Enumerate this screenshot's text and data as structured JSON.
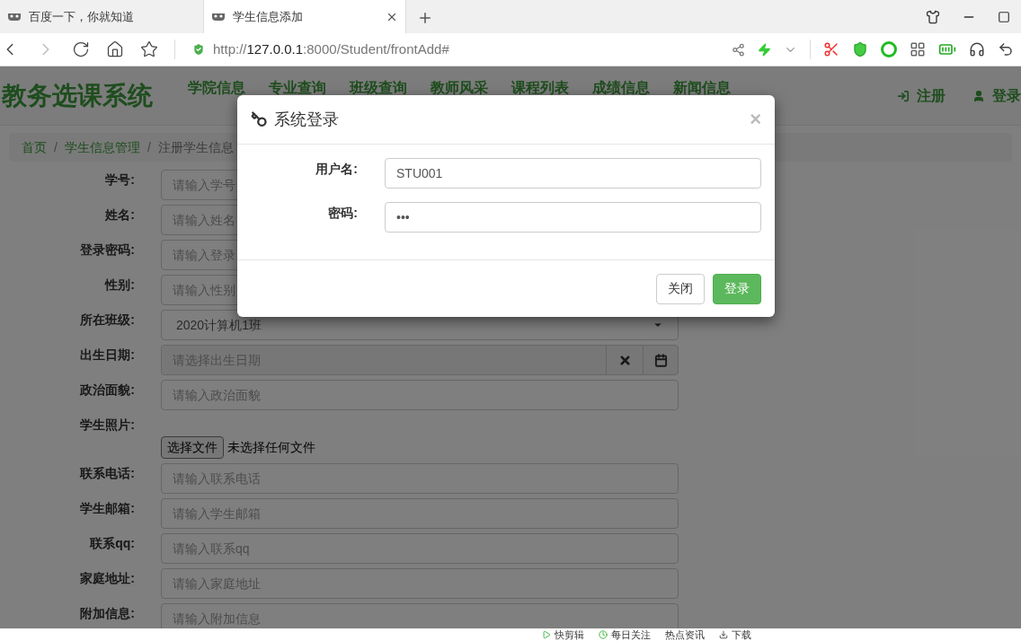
{
  "browser": {
    "tabs": [
      {
        "title": "百度一下，你就知道",
        "selected": false
      },
      {
        "title": "学生信息添加",
        "selected": true
      }
    ],
    "url": {
      "scheme": "http://",
      "host": "127.0.0.1",
      "path": ":8000/Student/frontAdd#"
    }
  },
  "navbar": {
    "brand": "教务选课系统",
    "items": [
      "学院信息",
      "专业查询",
      "班级查询",
      "教师风采",
      "课程列表",
      "成绩信息",
      "新闻信息"
    ],
    "right": [
      {
        "kind": "register",
        "label": "注册"
      },
      {
        "kind": "login",
        "label": "登录"
      }
    ]
  },
  "breadcrumb": {
    "items": [
      "首页",
      "学生信息管理",
      "注册学生信息"
    ],
    "separators": [
      "/",
      "/"
    ]
  },
  "form": [
    {
      "kind": "text",
      "label": "学号:",
      "placeholder": "请输入学号"
    },
    {
      "kind": "text",
      "label": "姓名:",
      "placeholder": "请输入姓名"
    },
    {
      "kind": "text",
      "label": "登录密码:",
      "placeholder": "请输入登录"
    },
    {
      "kind": "text",
      "label": "性别:",
      "placeholder": "请输入性别"
    },
    {
      "kind": "select",
      "label": "所在班级:",
      "value": "2020计算机1班"
    },
    {
      "kind": "date",
      "label": "出生日期:",
      "placeholder": "请选择出生日期"
    },
    {
      "kind": "text",
      "label": "政治面貌:",
      "placeholder": "请输入政治面貌"
    },
    {
      "kind": "file",
      "label": "学生照片:",
      "button": "选择文件",
      "status": "未选择任何文件"
    },
    {
      "kind": "text",
      "label": "联系电话:",
      "placeholder": "请输入联系电话"
    },
    {
      "kind": "text",
      "label": "学生邮箱:",
      "placeholder": "请输入学生邮箱"
    },
    {
      "kind": "text",
      "label": "联系qq:",
      "placeholder": "请输入联系qq"
    },
    {
      "kind": "text",
      "label": "家庭地址:",
      "placeholder": "请输入家庭地址"
    },
    {
      "kind": "text",
      "label": "附加信息:",
      "placeholder": "请输入附加信息"
    }
  ],
  "modal": {
    "title": "系统登录",
    "close": "×",
    "fields": [
      {
        "label": "用户名:",
        "value": "STU001"
      },
      {
        "label": "密码:",
        "value": "•••"
      }
    ],
    "buttons": [
      {
        "label": "关闭",
        "kind": "default"
      },
      {
        "label": "登录",
        "kind": "primary"
      }
    ]
  },
  "status_bar": [
    "快剪辑",
    "每日关注",
    "热点资讯",
    "下载"
  ]
}
